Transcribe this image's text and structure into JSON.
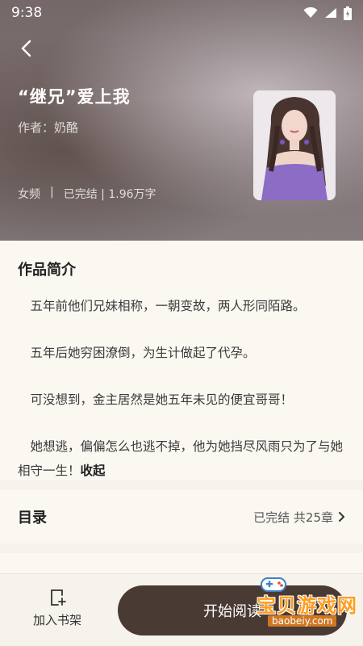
{
  "status_bar": {
    "time": "9:38",
    "icons": [
      "wifi-icon",
      "signal-icon",
      "battery-icon"
    ]
  },
  "book": {
    "title": "“继兄”爱上我",
    "author": "作者：奶酪",
    "category": "女频",
    "separator": "|",
    "status_words": "已完结 | 1.96万字"
  },
  "intro": {
    "heading": "作品简介",
    "paragraphs": [
      "五年前他们兄妹相称，一朝变故，两人形同陌路。",
      "五年后她穷困潦倒，为生计做起了代孕。",
      "可没想到，金主居然是她五年未见的便宜哥哥！",
      "她想逃，偏偏怎么也逃不掉，他为她挡尽风雨只为了与她相守一生！"
    ],
    "collapse_label": "收起"
  },
  "toc": {
    "heading": "目录",
    "status": "已完结 共25章"
  },
  "bottom_bar": {
    "shelf_label": "加入书架",
    "read_label": "开始阅读"
  },
  "watermark": {
    "text": "宝贝游戏网",
    "url": "baobeiy.com"
  },
  "colors": {
    "accent": "#4a3a34",
    "page_bg": "#f6f2ec",
    "card_bg": "#fbf8f2",
    "watermark": "#ff9d1f"
  }
}
